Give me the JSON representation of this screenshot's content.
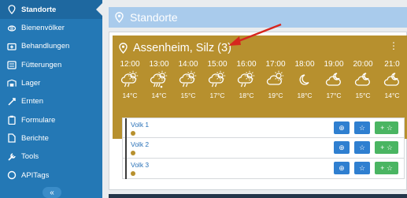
{
  "sidebar": {
    "items": [
      {
        "label": "Standorte",
        "icon": "map-pin-icon",
        "active": true
      },
      {
        "label": "Bienenvölker",
        "icon": "bee-icon"
      },
      {
        "label": "Behandlungen",
        "icon": "medkit-icon"
      },
      {
        "label": "Fütterungen",
        "icon": "feeding-icon"
      },
      {
        "label": "Lager",
        "icon": "warehouse-icon"
      },
      {
        "label": "Ernten",
        "icon": "harvest-icon"
      },
      {
        "label": "Formulare",
        "icon": "clipboard-icon"
      },
      {
        "label": "Berichte",
        "icon": "document-icon"
      },
      {
        "label": "Tools",
        "icon": "tools-icon"
      },
      {
        "label": "APITags",
        "icon": "circle-icon"
      }
    ],
    "collapse_label": "«"
  },
  "header": {
    "title": "Standorte",
    "icon": "map-pin-icon"
  },
  "location": {
    "name": "Assenheim, Silz (3)",
    "menu": "⋮",
    "color": "#b7902e"
  },
  "forecast": [
    {
      "time": "12:00",
      "temp": "14°C",
      "icon": "sun-cloud-rain"
    },
    {
      "time": "13:00",
      "temp": "14°C",
      "icon": "sun-cloud-heavy-rain"
    },
    {
      "time": "14:00",
      "temp": "15°C",
      "icon": "sun-cloud-rain"
    },
    {
      "time": "15:00",
      "temp": "17°C",
      "icon": "sun-cloud-rain"
    },
    {
      "time": "16:00",
      "temp": "18°C",
      "icon": "sun-cloud-rain"
    },
    {
      "time": "17:00",
      "temp": "19°C",
      "icon": "sun-cloud"
    },
    {
      "time": "18:00",
      "temp": "18°C",
      "icon": "moon"
    },
    {
      "time": "19:00",
      "temp": "17°C",
      "icon": "moon-cloud"
    },
    {
      "time": "20:00",
      "temp": "15°C",
      "icon": "moon-cloud"
    },
    {
      "time": "21:0",
      "temp": "14°C",
      "icon": "moon-cloud"
    }
  ],
  "colonies": [
    {
      "name": "Volk 1"
    },
    {
      "name": "Volk 2"
    },
    {
      "name": "Volk 3"
    }
  ],
  "buttons": {
    "zoom": "⊕",
    "star": "☆",
    "add": "+ ☆"
  }
}
